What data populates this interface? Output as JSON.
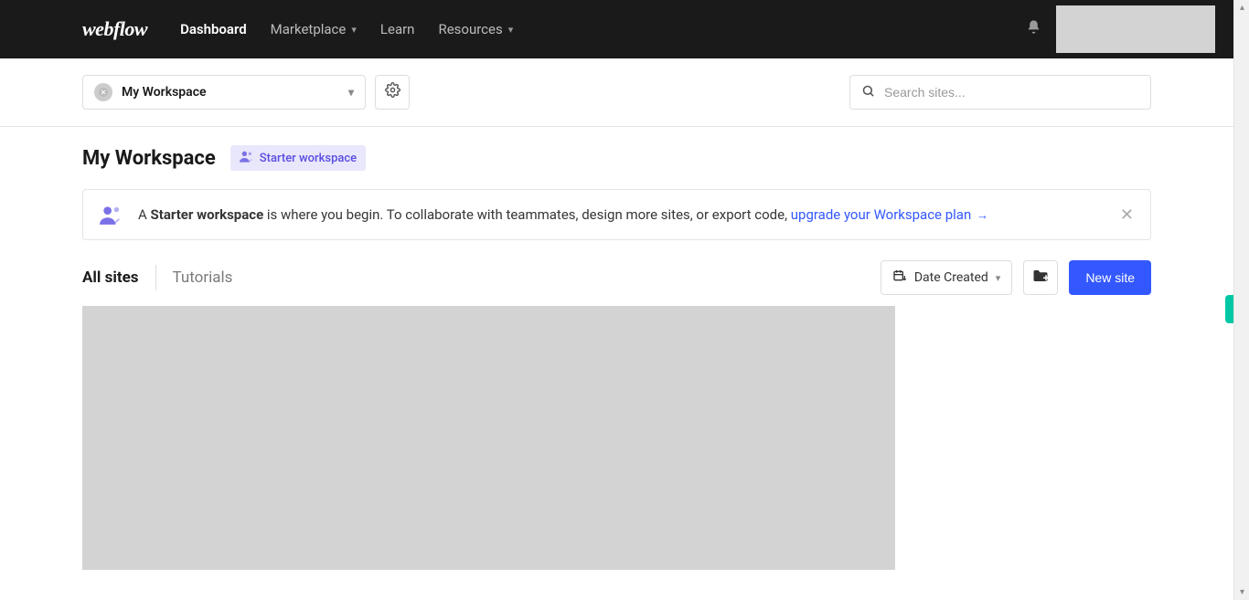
{
  "brand": "webflow",
  "nav": {
    "dashboard": "Dashboard",
    "marketplace": "Marketplace",
    "learn": "Learn",
    "resources": "Resources"
  },
  "workspace_selector": {
    "label": "My Workspace"
  },
  "search": {
    "placeholder": "Search sites..."
  },
  "heading": "My Workspace",
  "workspace_pill": "Starter workspace",
  "banner": {
    "prefix": "A ",
    "bold": "Starter workspace",
    "suffix": " is where you begin. To collaborate with teammates, design more sites, or export code, ",
    "link": "upgrade your Workspace plan"
  },
  "tabs": {
    "all_sites": "All sites",
    "tutorials": "Tutorials"
  },
  "sort": {
    "label": "Date Created"
  },
  "new_site": "New site"
}
